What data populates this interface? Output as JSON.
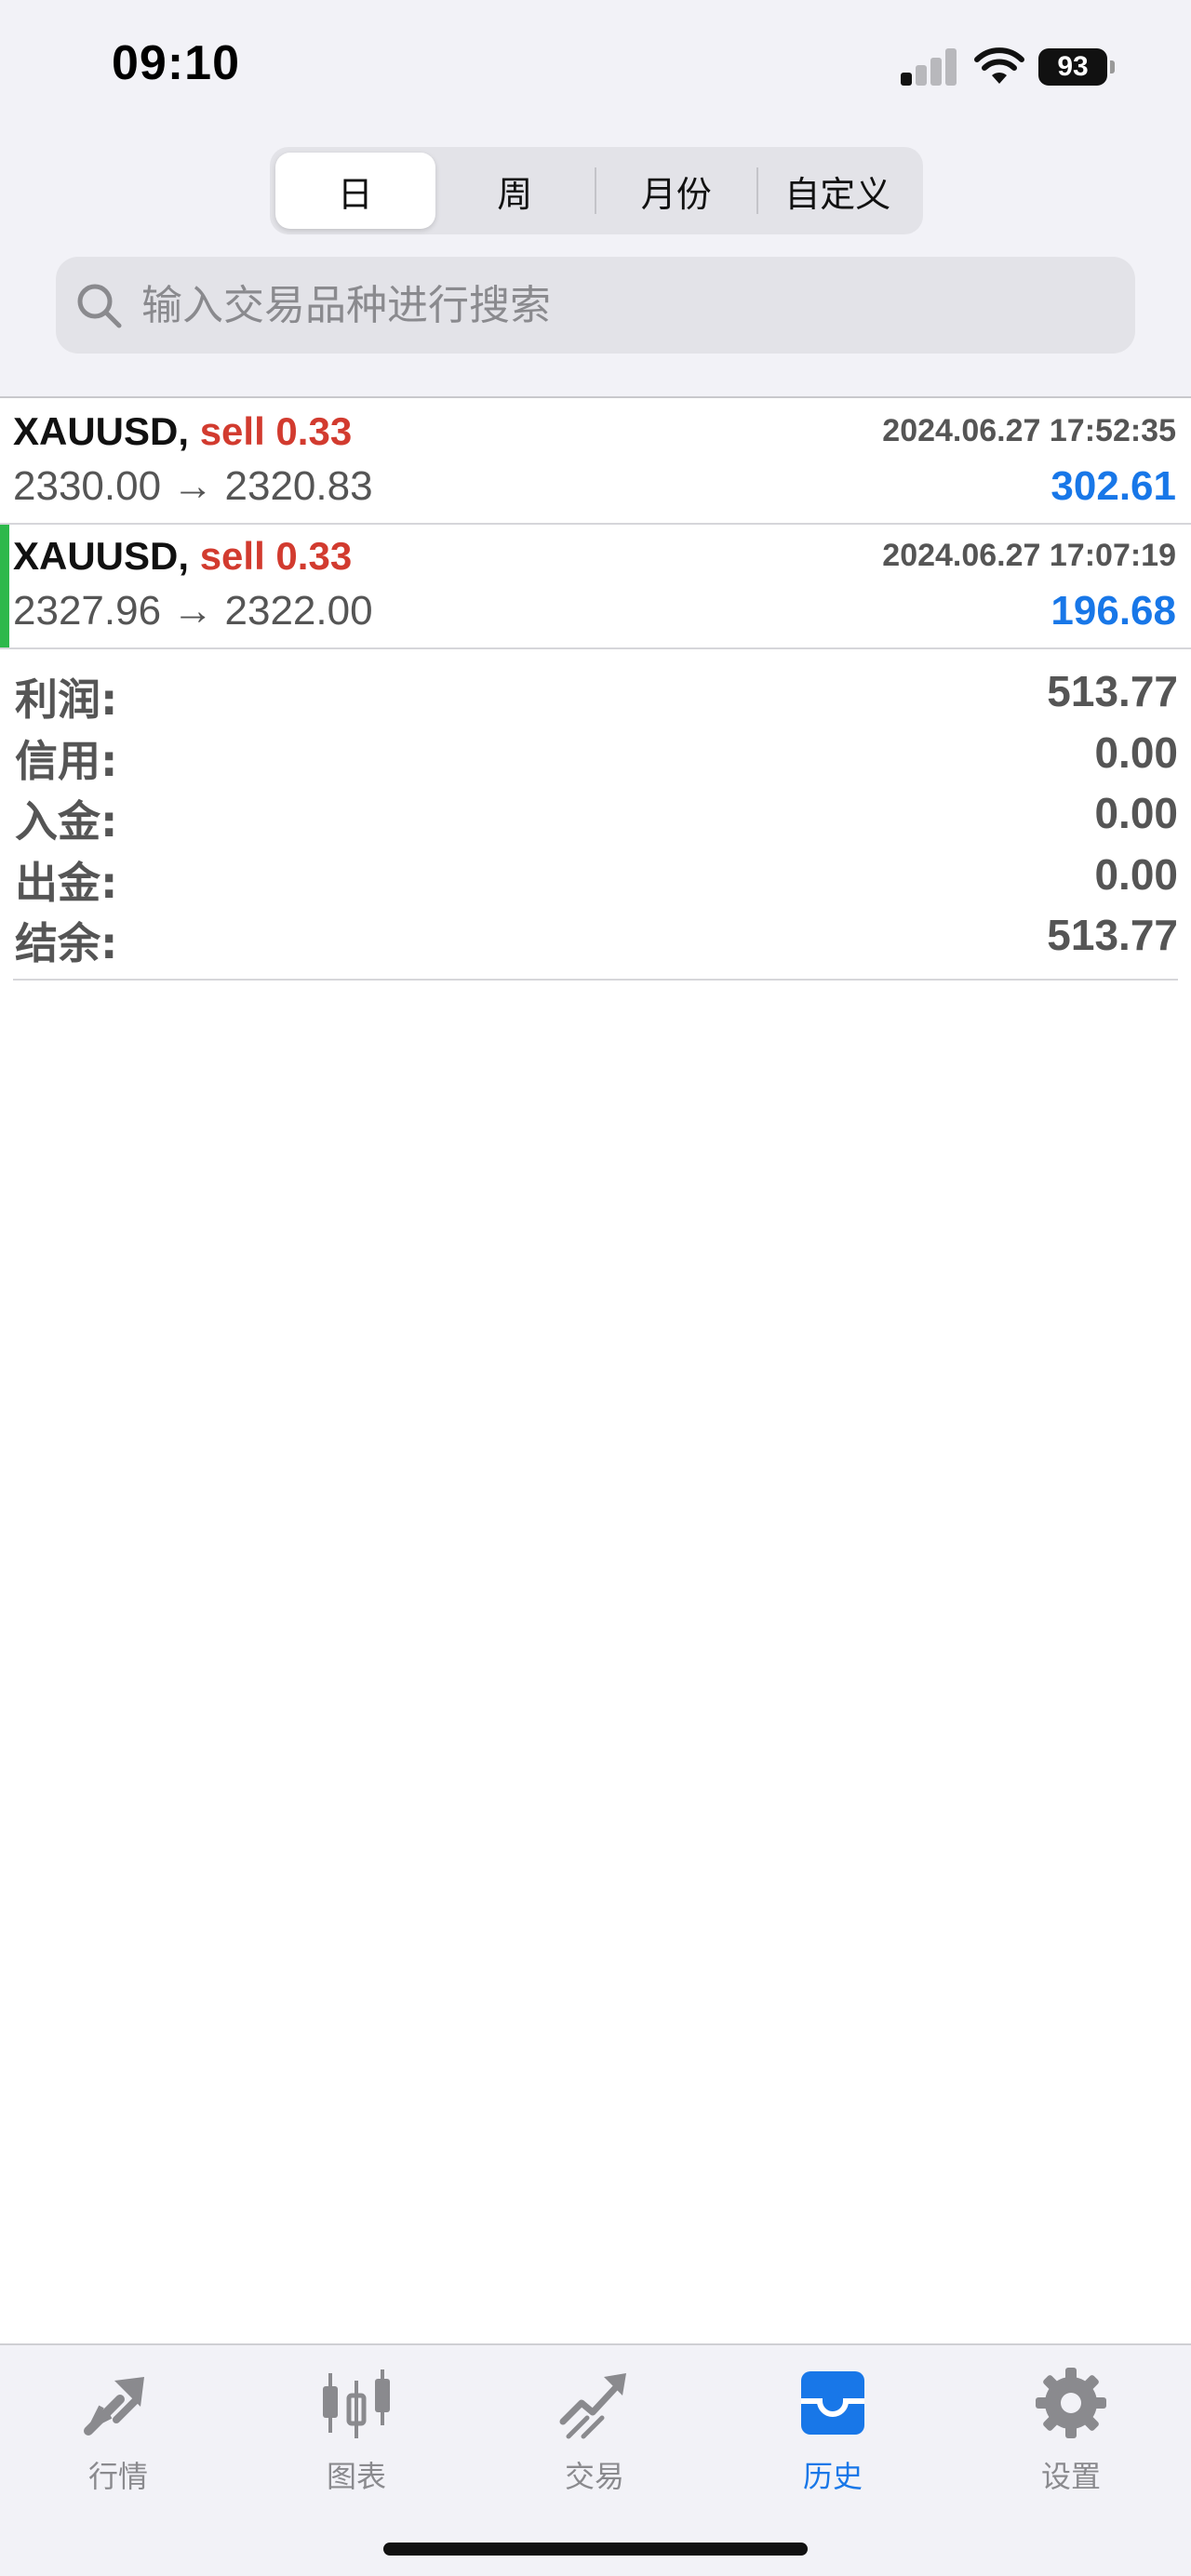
{
  "status_bar": {
    "time": "09:10",
    "battery": "93"
  },
  "period_tabs": [
    {
      "label": "日",
      "active": true
    },
    {
      "label": "周",
      "active": false
    },
    {
      "label": "月份",
      "active": false
    },
    {
      "label": "自定义",
      "active": false
    }
  ],
  "search": {
    "placeholder": "输入交易品种进行搜索"
  },
  "trades": [
    {
      "symbol": "XAUUSD,",
      "side": "sell 0.33",
      "time": "2024.06.27 17:52:35",
      "prices": "2330.00 → 2320.83",
      "profit": "302.61"
    },
    {
      "symbol": "XAUUSD,",
      "side": "sell 0.33",
      "time": "2024.06.27 17:07:19",
      "prices": "2327.96 → 2322.00",
      "profit": "196.68"
    }
  ],
  "summary": [
    {
      "label": "利润:",
      "value": "513.77"
    },
    {
      "label": "信用:",
      "value": "0.00"
    },
    {
      "label": "入金:",
      "value": "0.00"
    },
    {
      "label": "出金:",
      "value": "0.00"
    },
    {
      "label": "结余:",
      "value": "513.77"
    }
  ],
  "tabbar": [
    {
      "label": "行情",
      "icon": "quotes-icon",
      "active": false
    },
    {
      "label": "图表",
      "icon": "chart-candles-icon",
      "active": false
    },
    {
      "label": "交易",
      "icon": "trade-icon",
      "active": false
    },
    {
      "label": "历史",
      "icon": "history-inbox-icon",
      "active": true
    },
    {
      "label": "设置",
      "icon": "gear-icon",
      "active": false
    }
  ],
  "colors": {
    "accent": "#1877e8",
    "sell": "#d23b2f",
    "marker": "#2db84b",
    "inactive": "#8a8a8e"
  }
}
